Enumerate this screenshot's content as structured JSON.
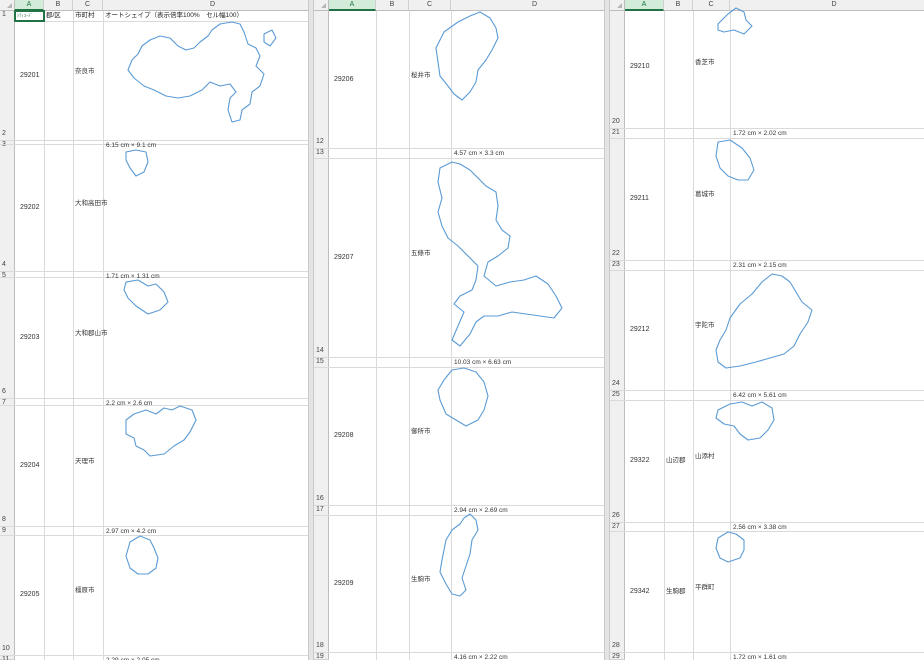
{
  "columns": [
    "A",
    "B",
    "C",
    "D"
  ],
  "header_row": {
    "a1": "ｼﾃｨｺｰﾄﾞ",
    "b1": "郡/区",
    "c1": "市町村",
    "d1": "オートシェイプ（表示倍率100%　セル幅100）"
  },
  "panes": [
    {
      "records": [
        {
          "row_top": "2",
          "row_bottom": "3",
          "code": "29201",
          "district": "",
          "city": "奈良市",
          "dims": "6.15 cm × 9.1 cm"
        },
        {
          "row_top": "4",
          "row_bottom": "5",
          "code": "29202",
          "district": "",
          "city": "大和高田市",
          "dims": "1.71 cm × 1.31 cm"
        },
        {
          "row_top": "6",
          "row_bottom": "7",
          "code": "29203",
          "district": "",
          "city": "大和郡山市",
          "dims": "2.2 cm × 2.6 cm"
        },
        {
          "row_top": "8",
          "row_bottom": "9",
          "code": "29204",
          "district": "",
          "city": "天理市",
          "dims": "2.97 cm × 4.2 cm"
        },
        {
          "row_top": "10",
          "row_bottom": "11",
          "code": "29205",
          "district": "",
          "city": "橿原市",
          "dims": "2.29 cm × 2.05 cm"
        }
      ]
    },
    {
      "records": [
        {
          "row_top": "12",
          "row_bottom": "13",
          "code": "29206",
          "district": "",
          "city": "桜井市",
          "dims": "4.57 cm × 3.3 cm"
        },
        {
          "row_top": "14",
          "row_bottom": "15",
          "code": "29207",
          "district": "",
          "city": "五條市",
          "dims": "10.03 cm × 6.63 cm"
        },
        {
          "row_top": "16",
          "row_bottom": "17",
          "code": "29208",
          "district": "",
          "city": "御所市",
          "dims": "2.94 cm × 2.69 cm"
        },
        {
          "row_top": "18",
          "row_bottom": "19",
          "code": "29209",
          "district": "",
          "city": "生駒市",
          "dims": "4.16 cm × 2.22 cm"
        }
      ]
    },
    {
      "records": [
        {
          "row_top": "20",
          "row_bottom": "21",
          "code": "29210",
          "district": "",
          "city": "香芝市",
          "dims": "1.72 cm × 2.02 cm"
        },
        {
          "row_top": "22",
          "row_bottom": "23",
          "code": "29211",
          "district": "",
          "city": "葛城市",
          "dims": "2.31 cm × 2.15 cm"
        },
        {
          "row_top": "24",
          "row_bottom": "25",
          "code": "29212",
          "district": "",
          "city": "宇陀市",
          "dims": "6.42 cm × 5.61 cm"
        },
        {
          "row_top": "26",
          "row_bottom": "27",
          "code": "29322",
          "district": "山辺郡",
          "city": "山添村",
          "dims": "2.56 cm × 3.38 cm"
        },
        {
          "row_top": "28",
          "row_bottom": "29",
          "code": "29342",
          "district": "生駒郡",
          "city": "平群町",
          "dims": "1.72 cm × 1.61 cm"
        }
      ]
    }
  ],
  "colors": {
    "shape_outline": "#5b9bd5",
    "selection": "#217346",
    "header_bg": "#f0f0f0",
    "gridline": "#dadada"
  }
}
